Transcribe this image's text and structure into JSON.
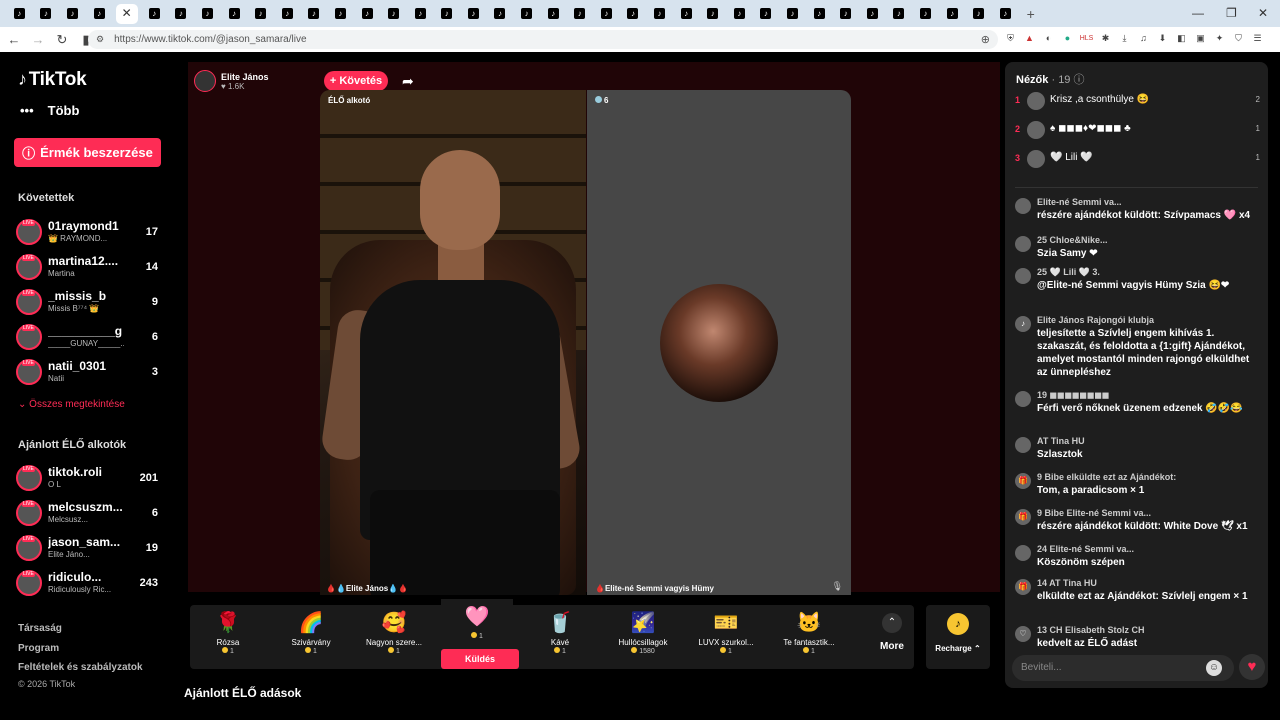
{
  "browser": {
    "tab_count": 38,
    "url": "https://www.tiktok.com/@jason_samara/live"
  },
  "sidebar": {
    "logo": "TikTok",
    "more": "Több",
    "coins_button": "Érmék beszerzése",
    "following_title": "Követettek",
    "following": [
      {
        "name": "01raymond1",
        "sub": "👑 RAYMOND...",
        "count": "17"
      },
      {
        "name": "martina12....",
        "sub": "Martina",
        "count": "14"
      },
      {
        "name": "_missis_b",
        "sub": "Missis B⁷⁷⁴ 👑",
        "count": "9"
      },
      {
        "name": "__________gu...",
        "sub": "_____GUNAY_____...",
        "count": "6"
      },
      {
        "name": "natii_0301",
        "sub": "Natii",
        "count": "3"
      }
    ],
    "see_all": "Összes megtekintése",
    "recommended_title": "Ajánlott ÉLŐ alkotók",
    "recommended": [
      {
        "name": "tiktok.roli",
        "sub": "O L",
        "count": "201"
      },
      {
        "name": "melcsuszm...",
        "sub": "Melcsusz...",
        "count": "6"
      },
      {
        "name": "jason_sam...",
        "sub": "Elite Jáno...",
        "count": "19"
      },
      {
        "name": "ridiculo...",
        "sub": "Ridiculously Ric...",
        "count": "243"
      }
    ],
    "footer": [
      "Társaság",
      "Program",
      "Feltételek és szabályzatok"
    ],
    "copyright": "© 2026 TikTok"
  },
  "stream": {
    "host_name": "Elite János",
    "host_likes": "1.6K",
    "follow_button": "+ Követés",
    "left_label": "ÉLŐ alkotó",
    "left_name": "Elite János",
    "right_viewers": "6",
    "right_name": "Elite-né Semmi vagyis Hümy"
  },
  "gifts": [
    {
      "name": "Rózsa",
      "price": "1",
      "icon": "🌹"
    },
    {
      "name": "Szivárvány",
      "price": "1",
      "icon": "🌈"
    },
    {
      "name": "Nagyon szere...",
      "price": "1",
      "icon": "🥰"
    },
    {
      "name": "",
      "price": "1",
      "icon": "🩷"
    },
    {
      "name": "Kávé",
      "price": "1",
      "icon": "🥤"
    },
    {
      "name": "Hullócsillagok",
      "price": "1580",
      "icon": "🌠"
    },
    {
      "name": "LUVX szurkol...",
      "price": "1",
      "icon": "🎫"
    },
    {
      "name": "Te fantasztik...",
      "price": "1",
      "icon": "🐱"
    }
  ],
  "send_label": "Küldés",
  "more_label": "More",
  "recharge_label": "Recharge",
  "recommended_live_title": "Ajánlott ÉLŐ adások",
  "chat": {
    "viewers_label": "Nézők",
    "viewers_count": "· 19",
    "top": [
      {
        "rank": "1",
        "name": "Krisz ,a csonthülye 😆",
        "count": "2"
      },
      {
        "rank": "2",
        "name": "♠ ◼◼◼♦❤◼◼◼ ♣",
        "count": "1"
      },
      {
        "rank": "3",
        "name": "🤍 Lili 🤍",
        "count": "1"
      }
    ],
    "messages": [
      {
        "head": "Elite-né Semmi va...",
        "text": "részére ajándékot küldött: Szívpamacs 🩷 x4",
        "avatar": ""
      },
      {
        "head": "25 Chloe&Nike...",
        "text": "Szia Samy ❤",
        "avatar": ""
      },
      {
        "head": "25 🤍 Lili 🤍 3.",
        "text": "@Elite-né Semmi vagyis Hümy Szia 😆❤",
        "avatar": ""
      },
      {
        "head": "Elite János Rajongói klubja",
        "text": "teljesítette a Szívlelj engem kihívás 1. szakaszát, és feloldotta a {1:gift} Ajándékot, amelyet mostantól minden rajongó elküldhet az ünnepléshez",
        "avatar": "♪"
      },
      {
        "head": "19 ◼◼◼◼◼◼◼◼",
        "text": "Férfi verő nőknek üzenem edzenek 🤣🤣😂",
        "avatar": ""
      },
      {
        "head": "AT Tina HU",
        "text": "Szlasztok",
        "avatar": ""
      },
      {
        "head": "9 Bibe elküldte ezt az Ajándékot:",
        "text": "Tom, a paradicsom × 1",
        "avatar": "🎁"
      },
      {
        "head": "9 Bibe Elite-né Semmi va...",
        "text": "részére ajándékot küldött: White Dove 🕊 x1",
        "avatar": "🎁"
      },
      {
        "head": "24 Elite-né Semmi va...",
        "text": "Köszönöm szépen",
        "avatar": ""
      },
      {
        "head": "14 AT Tina HU",
        "text": "elküldte ezt az Ajándékot: Szívlelj engem × 1",
        "avatar": "🎁"
      },
      {
        "head": "13 CH Elisabeth Stolz CH",
        "text": "kedvelt az ÉLŐ adást",
        "avatar": "♡"
      }
    ],
    "input_placeholder": "Beviteli..."
  }
}
